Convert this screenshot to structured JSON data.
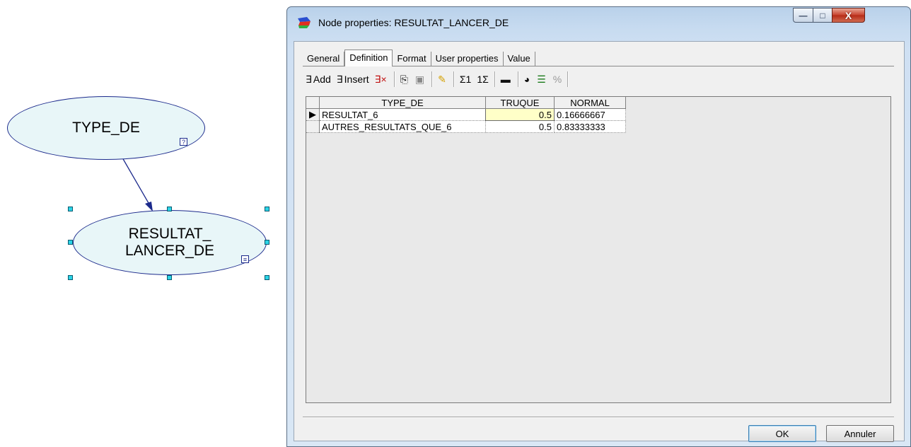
{
  "canvas": {
    "nodes": [
      {
        "label": "TYPE_DE",
        "badge": "?"
      },
      {
        "label_line1": "RESULTAT_",
        "label_line2": "LANCER_DE",
        "badge": "≡"
      }
    ]
  },
  "dialog": {
    "title": "Node properties: RESULTAT_LANCER_DE",
    "window_buttons": {
      "minimize": "—",
      "maximize": "□",
      "close": "X"
    },
    "tabs": [
      {
        "label": "General"
      },
      {
        "label": "Definition"
      },
      {
        "label": "Format"
      },
      {
        "label": "User properties"
      },
      {
        "label": "Value"
      }
    ],
    "toolbar": {
      "add_label": "Add",
      "insert_label": "Insert",
      "sum1": "Σ1",
      "one_sum": "1Σ",
      "percent": "%"
    },
    "table": {
      "headers": [
        "TYPE_DE",
        "TRUQUE",
        "NORMAL"
      ],
      "rows": [
        {
          "label": "RESULTAT_6",
          "truque": "0.5",
          "normal": "0.16666667"
        },
        {
          "label": "AUTRES_RESULTATS_QUE_6",
          "truque": "0.5",
          "normal": "0.83333333"
        }
      ]
    },
    "buttons": {
      "ok": "OK",
      "cancel": "Annuler"
    }
  },
  "colors": {
    "node_fill": "#e8f6f8",
    "node_border": "#1c2a8c",
    "handle": "#2bd4e6",
    "selected_cell": "#ffffc8"
  }
}
